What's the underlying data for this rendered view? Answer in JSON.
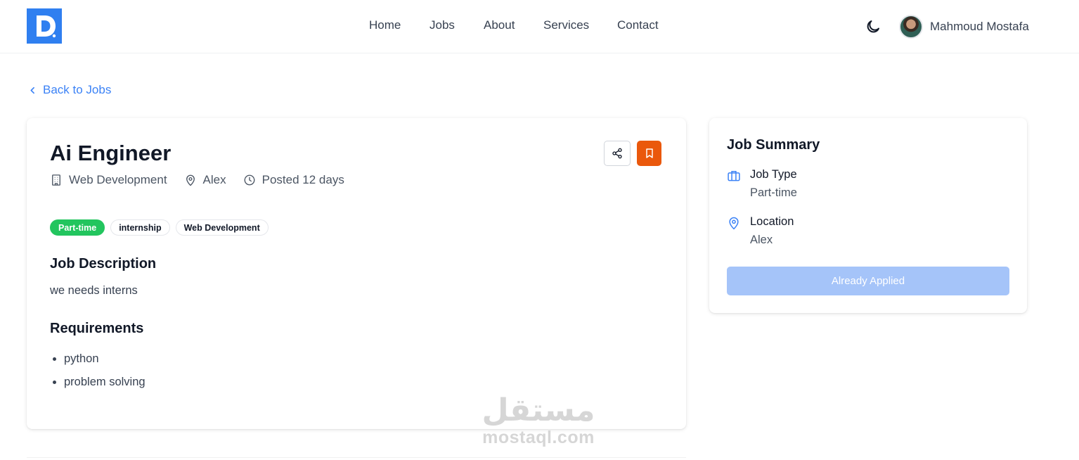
{
  "brand": {
    "logo_letter": "D",
    "color": "#2f7ff0"
  },
  "nav": {
    "items": [
      {
        "label": "Home"
      },
      {
        "label": "Jobs"
      },
      {
        "label": "About"
      },
      {
        "label": "Services"
      },
      {
        "label": "Contact"
      }
    ]
  },
  "header": {
    "theme_icon": "moon-icon",
    "user_name": "Mahmoud Mostafa"
  },
  "back_link": {
    "label": "Back to Jobs",
    "color": "#3b82f6"
  },
  "job": {
    "title": "Ai Engineer",
    "company": "Web Development",
    "location": "Alex",
    "posted": "Posted 12 days",
    "tags": [
      "Part-time",
      "internship",
      "Web Development"
    ],
    "description_title": "Job Description",
    "description": "we needs interns",
    "requirements_title": "Requirements",
    "requirements": [
      "python",
      "problem solving"
    ],
    "bookmark_color": "#ea580c",
    "tag_green_color": "#22c55e"
  },
  "summary": {
    "title": "Job Summary",
    "job_type_label": "Job Type",
    "job_type_value": "Part-time",
    "location_label": "Location",
    "location_value": "Alex",
    "button_label": "Already Applied",
    "button_color": "#a5c4f9"
  },
  "watermark": {
    "arabic": "مستقل",
    "latin": "mostaql.com"
  }
}
